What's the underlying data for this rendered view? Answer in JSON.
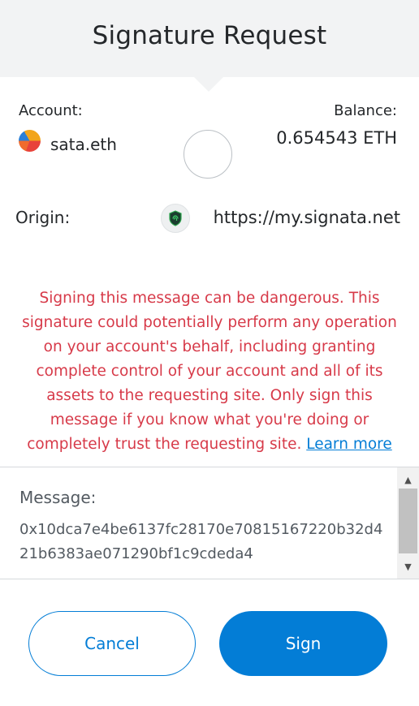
{
  "header": {
    "title": "Signature Request"
  },
  "account": {
    "label": "Account:",
    "name": "sata.eth",
    "avatar_icon": "account-identicon"
  },
  "balance": {
    "label": "Balance:",
    "value": "0.654543 ETH"
  },
  "origin": {
    "label": "Origin:",
    "url": "https://my.signata.net",
    "icon": "shield-site-icon"
  },
  "warning": {
    "text": "Signing this message can be dangerous. This signature could potentially perform any operation on your account's behalf, including granting complete control of your account and all of its assets to the requesting site. Only sign this message if you know what you're doing or completely trust the requesting site.",
    "link": "Learn more"
  },
  "message": {
    "label": "Message:",
    "value": "0x10dca7e4be6137fc28170e70815167220b32d421b6383ae071290bf1c9cdeda4"
  },
  "buttons": {
    "cancel": "Cancel",
    "sign": "Sign"
  },
  "colors": {
    "primary": "#037dd6",
    "danger": "#d73a49",
    "header_bg": "#f2f3f4"
  }
}
